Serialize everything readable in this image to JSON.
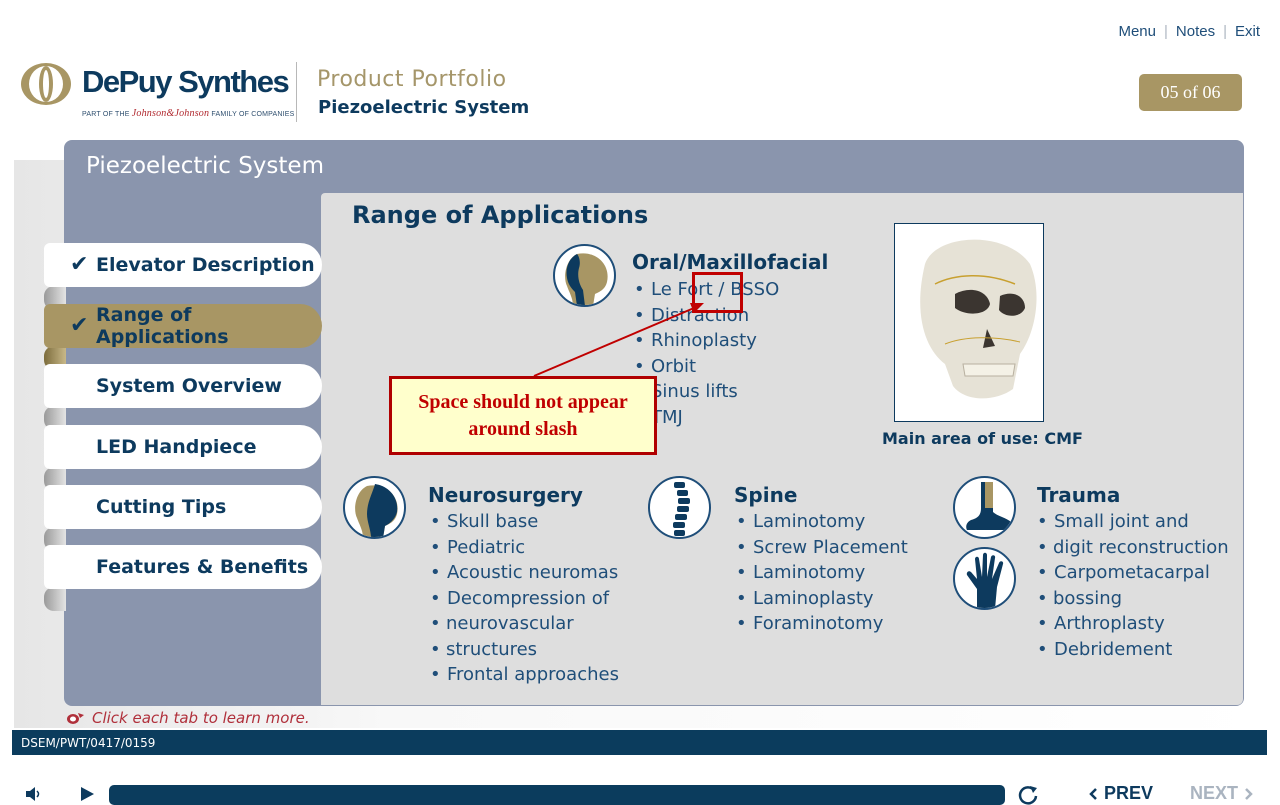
{
  "header": {
    "links": {
      "menu": "Menu",
      "notes": "Notes",
      "exit": "Exit"
    },
    "logo_brand": "DePuy Synthes",
    "logo_sub_prefix": "PART OF THE",
    "logo_sub_jj": "Johnson&Johnson",
    "logo_sub_suffix": "FAMILY OF COMPANIES",
    "product_title": "Product Portfolio",
    "product_subtitle": "Piezoelectric System",
    "page_counter": "05 of 06"
  },
  "panel": {
    "title": "Piezoelectric System"
  },
  "tabs": [
    {
      "label": "Elevator Description",
      "checked": true,
      "active": false,
      "check": "✔"
    },
    {
      "label": "Range of Applications",
      "checked": true,
      "active": true,
      "check": "✔"
    },
    {
      "label": "System Overview",
      "checked": false,
      "active": false
    },
    {
      "label": "LED Handpiece",
      "checked": false,
      "active": false
    },
    {
      "label": "Cutting Tips",
      "checked": false,
      "active": false
    },
    {
      "label": "Features & Benefits",
      "checked": false,
      "active": false
    }
  ],
  "content": {
    "title": "Range of Applications",
    "oral": {
      "title": "Oral/Maxillofacial",
      "items": [
        "Le Fort / BSSO",
        "Distraction",
        "Rhinoplasty",
        "Orbit",
        "Sinus lifts",
        "TMJ"
      ]
    },
    "neuro": {
      "title": "Neurosurgery",
      "items": [
        "Skull base",
        "Pediatric",
        "Acoustic neuromas",
        "Decompression of",
        "neurovascular",
        "structures",
        "Frontal approaches"
      ]
    },
    "spine": {
      "title": "Spine",
      "items": [
        "Laminotomy",
        "Screw Placement",
        "Laminotomy",
        "Laminoplasty",
        "Foraminotomy"
      ]
    },
    "trauma": {
      "title": "Trauma",
      "items": [
        "Small joint and",
        "digit reconstruction",
        "Carpometacarpal",
        "bossing",
        "Arthroplasty",
        "Debridement"
      ]
    },
    "photo_caption": "Main area of use: CMF"
  },
  "annotation": {
    "callout": "Space should not appear around slash"
  },
  "hint": "Click each tab to learn more.",
  "footer_code": "DSEM/PWT/0417/0159",
  "player": {
    "prev": "PREV",
    "next": "NEXT",
    "progress": 1.0
  },
  "colors": {
    "navy": "#0d3a5e",
    "gold": "#a89664",
    "panel": "#8a95ad",
    "content_bg": "#dedede",
    "annotation_red": "#c00000"
  },
  "icons": [
    "speaker-icon",
    "play-icon",
    "replay-icon",
    "chevron-left-icon",
    "chevron-right-icon",
    "head-profile-icon",
    "spine-icon",
    "foot-icon",
    "hand-icon",
    "checkmark-icon",
    "mouse-pointer-icon"
  ]
}
